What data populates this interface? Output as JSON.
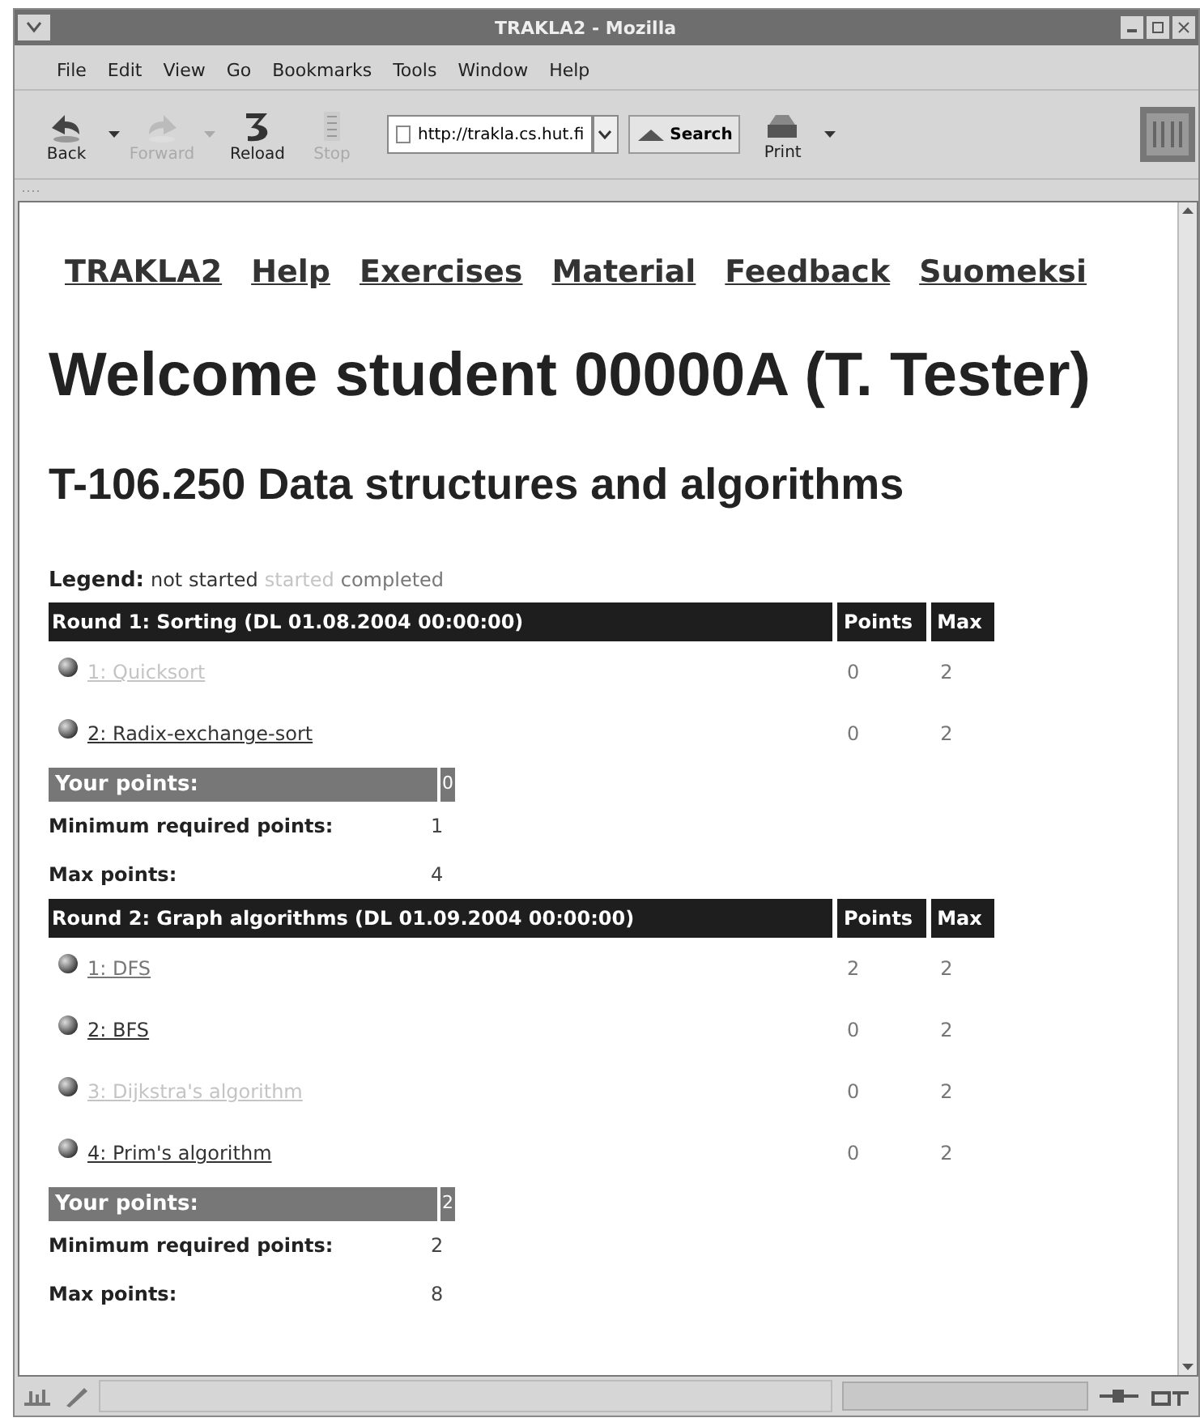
{
  "window": {
    "title": "TRAKLA2 - Mozilla"
  },
  "menu": [
    {
      "label": "File"
    },
    {
      "label": "Edit"
    },
    {
      "label": "View"
    },
    {
      "label": "Go"
    },
    {
      "label": "Bookmarks"
    },
    {
      "label": "Tools"
    },
    {
      "label": "Window"
    },
    {
      "label": "Help"
    }
  ],
  "toolbar": [
    {
      "label": "Back",
      "kind": "back",
      "disabled": false,
      "dropdown": true
    },
    {
      "label": "Forward",
      "kind": "forward",
      "disabled": true,
      "dropdown": true
    },
    {
      "label": "Reload",
      "kind": "reload",
      "disabled": false,
      "dropdown": false
    },
    {
      "label": "Stop",
      "kind": "stop",
      "disabled": true,
      "dropdown": false
    }
  ],
  "address": {
    "value": "http://trakla.cs.hut.fi"
  },
  "search_button": {
    "label": "Search"
  },
  "print_button": {
    "label": "Print"
  },
  "nav": [
    {
      "label": "TRAKLA2"
    },
    {
      "label": "Help"
    },
    {
      "label": "Exercises"
    },
    {
      "label": "Material"
    },
    {
      "label": "Feedback"
    },
    {
      "label": "Suomeksi"
    }
  ],
  "heading": "Welcome student 00000A (T. Tester)",
  "course": "T-106.250 Data structures and algorithms",
  "legend": {
    "label": "Legend:",
    "items": [
      {
        "text": "not started",
        "color": "#333333"
      },
      {
        "text": "started",
        "color": "#c4c4c4"
      },
      {
        "text": "completed",
        "color": "#777777"
      }
    ]
  },
  "rounds": [
    {
      "title": "Round 1: Sorting (DL 01.08.2004 00:00:00)",
      "points_header": "Points",
      "max_header": "Max",
      "exercises": [
        {
          "label": "1: Quicksort",
          "color": "#c4c4c4",
          "points": "0",
          "max": "2"
        },
        {
          "label": "2: Radix-exchange-sort",
          "color": "#333333",
          "points": "0",
          "max": "2"
        }
      ],
      "your_points_label": "Your points:",
      "your_points": "0",
      "min_label": "Minimum required points:",
      "min": "1",
      "max_label": "Max points:",
      "max": "4"
    },
    {
      "title": "Round 2: Graph algorithms (DL 01.09.2004 00:00:00)",
      "points_header": "Points",
      "max_header": "Max",
      "exercises": [
        {
          "label": "1: DFS",
          "color": "#777777",
          "points": "2",
          "max": "2"
        },
        {
          "label": "2: BFS",
          "color": "#333333",
          "points": "0",
          "max": "2"
        },
        {
          "label": "3: Dijkstra's algorithm",
          "color": "#c4c4c4",
          "points": "0",
          "max": "2"
        },
        {
          "label": "4: Prim's algorithm",
          "color": "#333333",
          "points": "0",
          "max": "2"
        }
      ],
      "your_points_label": "Your points:",
      "your_points": "2",
      "min_label": "Minimum required points:",
      "min": "2",
      "max_label": "Max points:",
      "max": "8"
    }
  ]
}
